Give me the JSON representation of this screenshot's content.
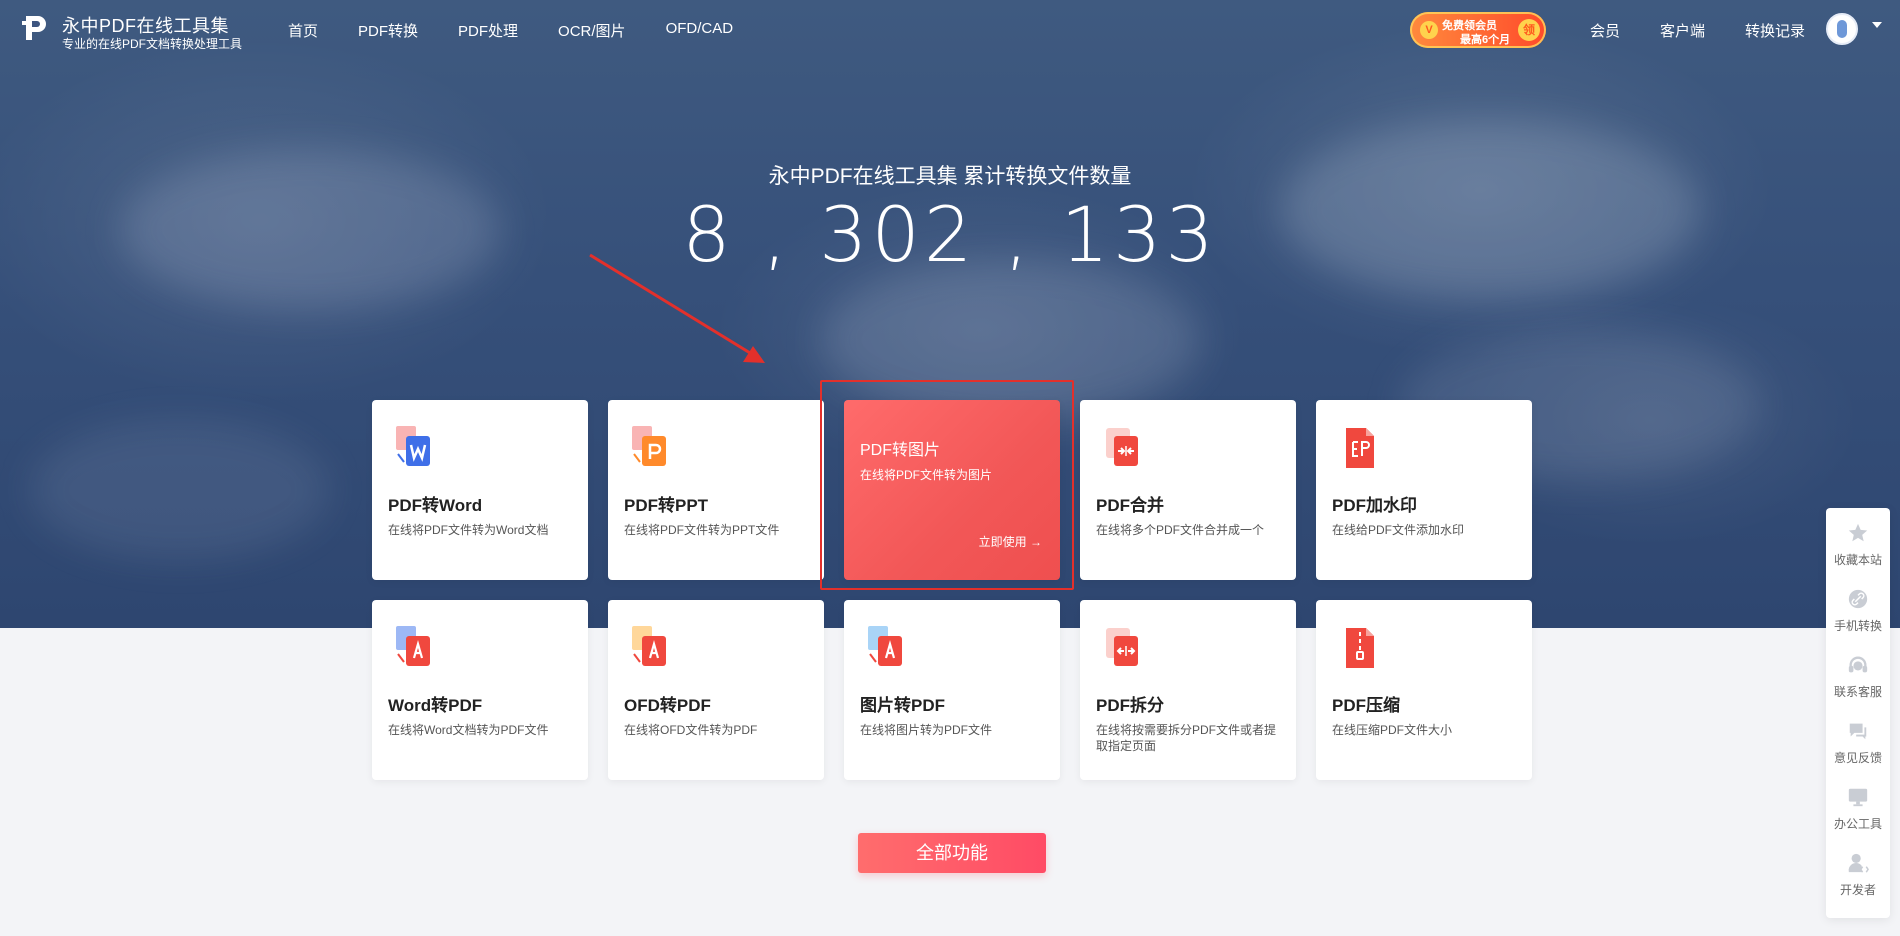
{
  "header": {
    "brand_title": "永中PDF在线工具集",
    "brand_subtitle": "专业的在线PDF文档转换处理工具",
    "nav": [
      "首页",
      "PDF转换",
      "PDF处理",
      "OCR/图片",
      "OFD/CAD"
    ],
    "promo": {
      "line1": "免费领会员",
      "line2": "最高6个月",
      "badge": "V",
      "coin": "领"
    },
    "right_nav": [
      "会员",
      "客户端",
      "转换记录"
    ]
  },
  "hero": {
    "counter_label": "永中PDF在线工具集  累计转换文件数量",
    "counter_value": "8 , 302 , 133"
  },
  "cards": [
    {
      "title": "PDF转Word",
      "desc": "在线将PDF文件转为Word文档",
      "icon": "pdf-to-word-icon"
    },
    {
      "title": "PDF转PPT",
      "desc": "在线将PDF文件转为PPT文件",
      "icon": "pdf-to-ppt-icon"
    },
    {
      "title": "PDF转图片",
      "desc": "在线将PDF文件转为图片",
      "icon": "pdf-to-image-icon",
      "cta": "立即使用 →"
    },
    {
      "title": "PDF合并",
      "desc": "在线将多个PDF文件合并成一个",
      "icon": "pdf-merge-icon"
    },
    {
      "title": "PDF加水印",
      "desc": "在线给PDF文件添加水印",
      "icon": "pdf-watermark-icon"
    },
    {
      "title": "Word转PDF",
      "desc": "在线将Word文档转为PDF文件",
      "icon": "word-to-pdf-icon"
    },
    {
      "title": "OFD转PDF",
      "desc": "在线将OFD文件转为PDF",
      "icon": "ofd-to-pdf-icon"
    },
    {
      "title": "图片转PDF",
      "desc": "在线将图片转为PDF文件",
      "icon": "image-to-pdf-icon"
    },
    {
      "title": "PDF拆分",
      "desc": "在线将按需要拆分PDF文件或者提取指定页面",
      "icon": "pdf-split-icon"
    },
    {
      "title": "PDF压缩",
      "desc": "在线压缩PDF文件大小",
      "icon": "pdf-compress-icon"
    }
  ],
  "all_features_label": "全部功能",
  "sidebar": [
    {
      "label": "收藏本站",
      "icon": "star-icon"
    },
    {
      "label": "手机转换",
      "icon": "link-icon"
    },
    {
      "label": "联系客服",
      "icon": "headset-icon"
    },
    {
      "label": "意见反馈",
      "icon": "chat-icon"
    },
    {
      "label": "办公工具",
      "icon": "monitor-icon"
    },
    {
      "label": "开发者",
      "icon": "developer-icon"
    }
  ],
  "colors": {
    "accent": "#f25757",
    "hero_bg": "#36507a",
    "page_bg": "#f3f4f7",
    "annotation_red": "#e3302b"
  }
}
